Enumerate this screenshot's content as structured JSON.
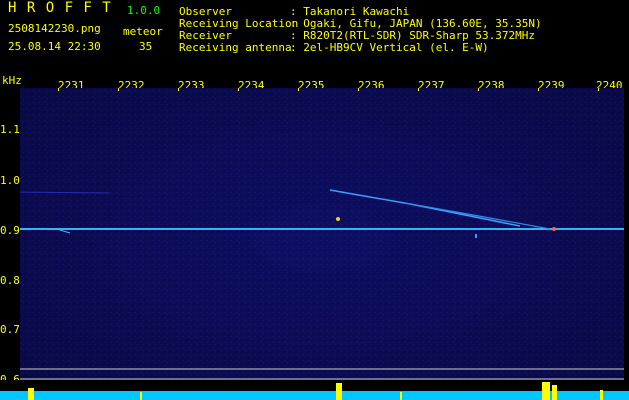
{
  "app": {
    "title": "H R O F F T",
    "version": "1.0.0",
    "filename": "2508142230.png",
    "datetime": "25.08.14 22:30",
    "event_label": "meteor",
    "event_count": "35"
  },
  "info": [
    {
      "label": "Observer",
      "value": ": Takanori Kawachi"
    },
    {
      "label": "Receiving Location",
      "value": ": Ogaki, Gifu, JAPAN (136.60E, 35.35N)"
    },
    {
      "label": "Receiver",
      "value": ": R820T2(RTL-SDR) SDR-Sharp 53.372MHz"
    },
    {
      "label": "Receiving antenna",
      "value": ": 2el-HB9CV Vertical (el. E-W)"
    }
  ],
  "axes": {
    "y_unit": "kHz",
    "x_ticks": [
      "2231",
      "2232",
      "2233",
      "2234",
      "2235",
      "2236",
      "2237",
      "2238",
      "2239",
      "2240"
    ],
    "y_ticks": [
      "1.1",
      "1.0",
      "0.9",
      "0.8",
      "0.7",
      "0.6"
    ]
  },
  "colors": {
    "text": "#ffff00",
    "background": "#000000",
    "spectrum": "#0a0a5a",
    "carrier": "#30b0ff",
    "level_bar": "#00c8ff"
  }
}
